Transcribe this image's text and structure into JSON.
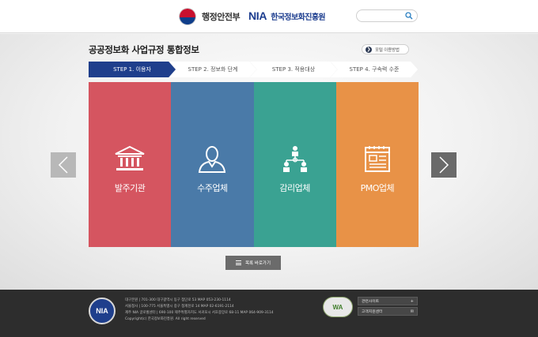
{
  "header": {
    "ministry_name": "행정안전부",
    "nia_mark": "NIA",
    "nia_name": "한국정보화진흥원",
    "search_placeholder": ""
  },
  "page": {
    "title": "공공정보화 사업규정 통합정보",
    "help_label": "포털 이용방법"
  },
  "steps": [
    {
      "label": "STEP 1. 이용자",
      "active": true
    },
    {
      "label": "STEP 2. 정보화 단계",
      "active": false
    },
    {
      "label": "STEP 3. 적용대상",
      "active": false
    },
    {
      "label": "STEP 4. 구속력 수준",
      "active": false
    }
  ],
  "cards": [
    {
      "label": "발주기관",
      "icon": "institution-icon",
      "color": "#d55560"
    },
    {
      "label": "수주업체",
      "icon": "person-icon",
      "color": "#4a7aa8"
    },
    {
      "label": "감리업체",
      "icon": "org-chart-icon",
      "color": "#3aa292"
    },
    {
      "label": "PMO업체",
      "icon": "document-list-icon",
      "color": "#e89247"
    }
  ],
  "list_button": {
    "label": "목록 바로가기"
  },
  "footer": {
    "logo_text": "NIA",
    "lines": [
      "대구본원 | 701-300 대구광역시 동구 첨단로 53 MAP 053-230-1114",
      "서울청사 | 100-775 서울특별시 중구 청계천로 14 MAP 02-6191-2114",
      "제주 NIA 글로벌센터 | 690-100 제주특별자치도 서귀포시 서호중앙로 68-11 MAP 064-909-3114",
      "Copyright(c) 한국정보화진흥원. All right reserved"
    ],
    "wa_mark": "WA",
    "select1": "관련사이트",
    "select2": "고객지원센터"
  }
}
